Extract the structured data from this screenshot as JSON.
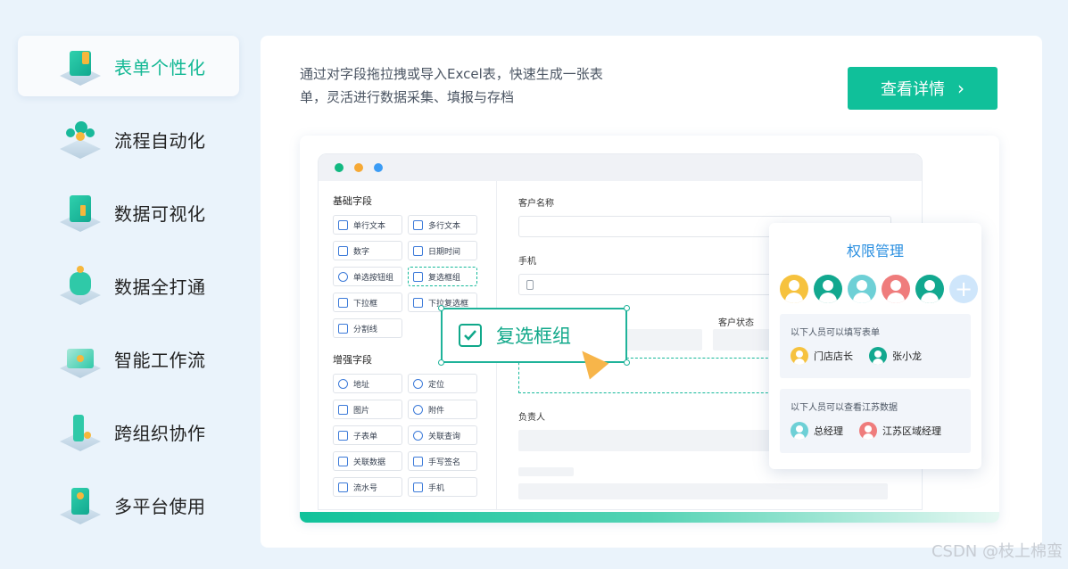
{
  "nav": {
    "items": [
      {
        "label": "表单个性化",
        "icon": "form-icon",
        "active": true
      },
      {
        "label": "流程自动化",
        "icon": "flow-icon",
        "active": false
      },
      {
        "label": "数据可视化",
        "icon": "chart-icon",
        "active": false
      },
      {
        "label": "数据全打通",
        "icon": "database-icon",
        "active": false
      },
      {
        "label": "智能工作流",
        "icon": "workflow-icon",
        "active": false
      },
      {
        "label": "跨组织协作",
        "icon": "collaboration-icon",
        "active": false
      },
      {
        "label": "多平台使用",
        "icon": "platform-icon",
        "active": false
      }
    ]
  },
  "main": {
    "description": "通过对字段拖拉拽或导入Excel表，快速生成一张表单，灵活进行数据采集、填报与存档",
    "detail_button": "查看详情",
    "accent": "#10c09a"
  },
  "mock": {
    "basic_title": "基础字段",
    "basic_fields": [
      "单行文本",
      "多行文本",
      "数字",
      "日期时间",
      "单选按钮组",
      "复选框组",
      "下拉框",
      "下拉复选框",
      "分割线"
    ],
    "enhanced_title": "增强字段",
    "enhanced_fields": [
      "地址",
      "定位",
      "图片",
      "附件",
      "子表单",
      "关联查询",
      "关联数据",
      "手写签名",
      "流水号",
      "手机"
    ],
    "form": {
      "customer_name": "客户名称",
      "phone": "手机",
      "customer_status": "客户状态",
      "owner": "负责人"
    },
    "drag_chip": "复选框组"
  },
  "permission": {
    "title": "权限管理",
    "fill_title": "以下人员可以填写表单",
    "fill_users": [
      "门店店长",
      "张小龙"
    ],
    "view_title": "以下人员可以查看江苏数据",
    "view_users": [
      "总经理",
      "江苏区域经理"
    ],
    "avatar_colors": [
      "#f6c23e",
      "#12a88f",
      "#6ed0d6",
      "#ef7c7c",
      "#12a88f"
    ]
  },
  "watermark": "CSDN @枝上棉蛮"
}
